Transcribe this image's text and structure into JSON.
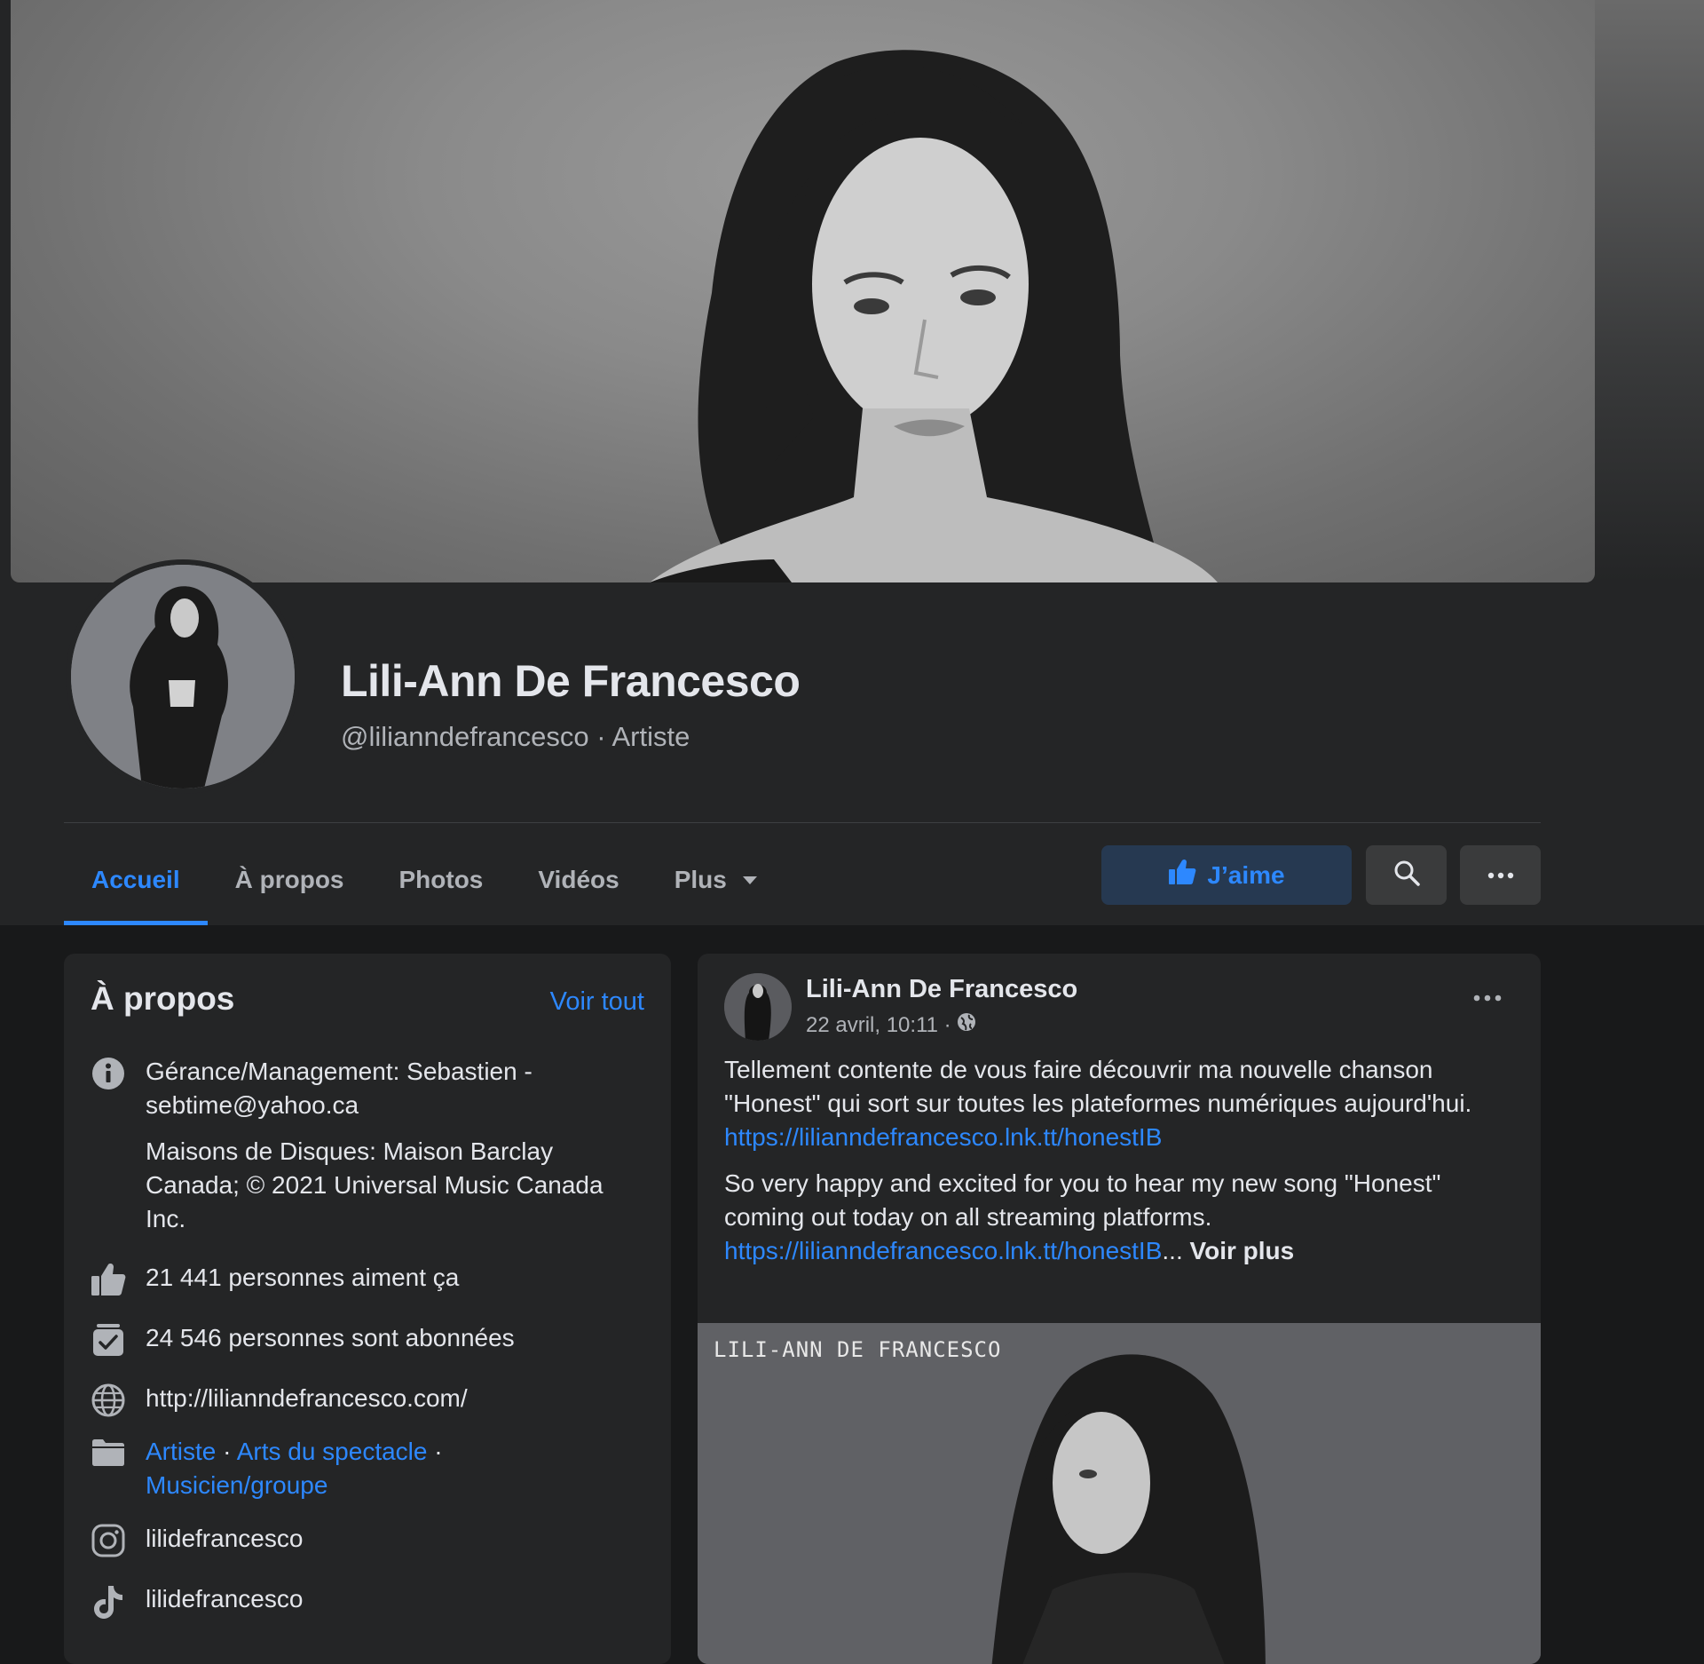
{
  "page": {
    "name": "Lili-Ann De Francesco",
    "handle": "@lilianndefrancesco · Artiste"
  },
  "tabs": [
    {
      "label": "Accueil",
      "active": true
    },
    {
      "label": "À propos"
    },
    {
      "label": "Photos"
    },
    {
      "label": "Vidéos"
    },
    {
      "label": "Plus"
    }
  ],
  "actions": {
    "like_label": "J’aime",
    "like_icon": "thumbs-up-icon",
    "search_icon": "search-icon",
    "more_icon": "more-horizontal-icon"
  },
  "about": {
    "title": "À propos",
    "see_all": "Voir tout",
    "management": "Gérance/Management: Sebastien - sebtime@yahoo.ca",
    "labels": "Maisons de Disques: Maison Barclay Canada; © 2021 Universal Music Canada Inc.",
    "likes": "21 441 personnes aiment ça",
    "followers": "24 546 personnes sont abonnées",
    "website": "http://lilianndefrancesco.com/",
    "categories": [
      "Artiste",
      "Arts du spectacle",
      "Musicien/groupe"
    ],
    "category_sep": " · ",
    "instagram": "lilidefrancesco",
    "tiktok": "lilidefrancesco"
  },
  "post": {
    "author": "Lili-Ann De Francesco",
    "date": "22 avril, 10:11 ·",
    "text_fr": "Tellement contente de vous faire découvrir ma nouvelle chanson \"Honest\" qui sort sur toutes les plateformes numériques aujourd'hui.",
    "link_fr": "https://lilianndefrancesco.lnk.tt/honestIB",
    "text_en": "So very happy and excited for you to hear my new song \"Honest\" coming out today on all streaming platforms.",
    "link_en": "https://lilianndefrancesco.lnk.tt/honestIB",
    "ellipsis": "...",
    "see_more": "Voir plus",
    "album_text": "LILI-ANN  DE FRANCESCO"
  },
  "colors": {
    "accent": "#2d88ff",
    "card": "#242526",
    "background": "#18191a",
    "like_bg": "#263951"
  }
}
